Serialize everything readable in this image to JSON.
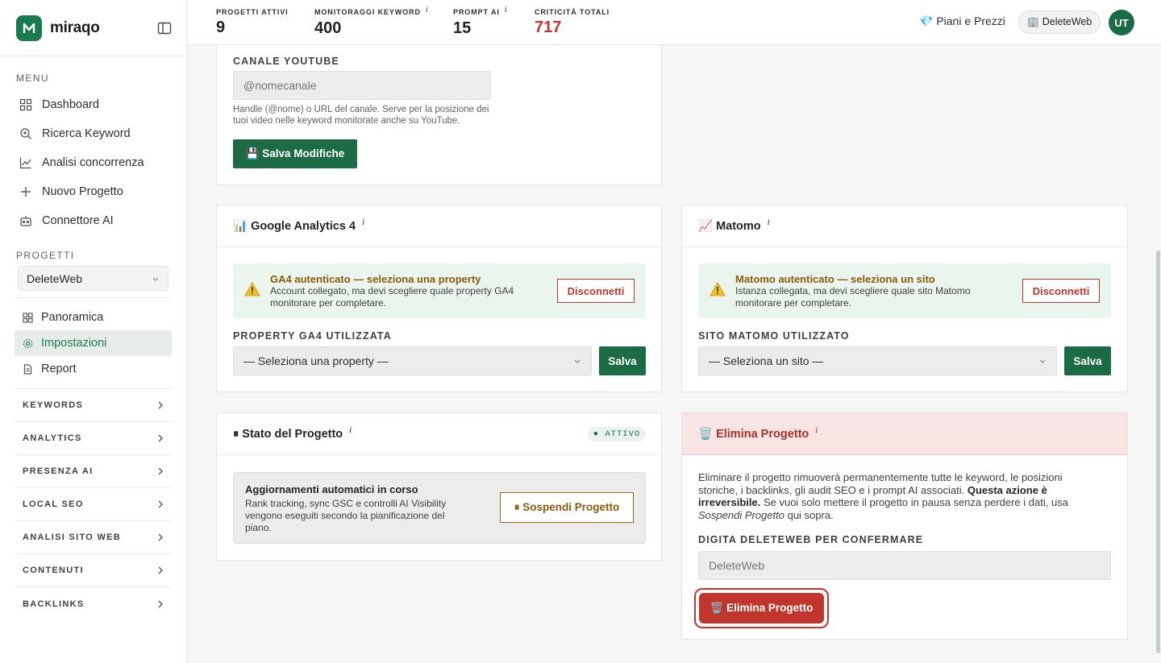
{
  "brand": {
    "name": "miraqo"
  },
  "sidebar": {
    "menu_label": "MENU",
    "menu_items": [
      {
        "label": "Dashboard"
      },
      {
        "label": "Ricerca Keyword"
      },
      {
        "label": "Analisi concorrenza"
      },
      {
        "label": "Nuovo Progetto"
      },
      {
        "label": "Connettore AI"
      }
    ],
    "projects_label": "PROGETTI",
    "project_select": "DeleteWeb",
    "project_items": [
      {
        "label": "Panoramica"
      },
      {
        "label": "Impostazioni"
      },
      {
        "label": "Report"
      }
    ],
    "groups": [
      {
        "label": "KEYWORDS"
      },
      {
        "label": "ANALYTICS"
      },
      {
        "label": "PRESENZA AI"
      },
      {
        "label": "LOCAL SEO"
      },
      {
        "label": "ANALISI SITO WEB"
      },
      {
        "label": "CONTENUTI"
      },
      {
        "label": "BACKLINKS"
      }
    ]
  },
  "topbar": {
    "stats": [
      {
        "label": "PROGETTI ATTIVI",
        "info": "",
        "value": "9",
        "color": "#1f2422"
      },
      {
        "label": "MONITORAGGI KEYWORD",
        "info": "i",
        "value": "400",
        "color": "#1f2422"
      },
      {
        "label": "PROMPT AI",
        "info": "i",
        "value": "15",
        "color": "#1f2422"
      },
      {
        "label": "CRITICITÀ TOTALI",
        "info": "",
        "value": "717",
        "color": "#c0362c"
      }
    ],
    "plans_label": "💎 Piani e Prezzi",
    "workspace_label": "🏢 DeleteWeb",
    "avatar_initials": "UT"
  },
  "youtube": {
    "label": "CANALE YOUTUBE",
    "placeholder": "@nomecanale",
    "help": "Handle (@nome) o URL del canale. Serve per la posizione dei tuoi video nelle keyword monitorate anche su YouTube.",
    "save_label": "💾 Salva Modifiche"
  },
  "ga4": {
    "title": "📊 Google Analytics 4",
    "info": "i",
    "alert_title": "GA4 autenticato — seleziona una property",
    "alert_text": "Account collegato, ma devi scegliere quale property GA4 monitorare per completare.",
    "disconnect_label": "Disconnetti",
    "field_label": "PROPERTY GA4 UTILIZZATA",
    "select_value": "— Seleziona una property —",
    "save_label": "Salva"
  },
  "matomo": {
    "title": "📈 Matomo",
    "info": "i",
    "alert_title": "Matomo autenticato — seleziona un sito",
    "alert_text": "Istanza collegata, ma devi scegliere quale sito Matomo monitorare per completare.",
    "disconnect_label": "Disconnetti",
    "field_label": "SITO MATOMO UTILIZZATO",
    "select_value": "— Seleziona un sito —",
    "save_label": "Salva"
  },
  "status": {
    "title": "⏸ Stato del Progetto",
    "info": "i",
    "badge": "● ATTIVO",
    "box_title": "Aggiornamenti automatici in corso",
    "box_text": "Rank tracking, sync GSC e controlli AI Visibility vengono eseguiti secondo la pianificazione del piano.",
    "suspend_label": "⏸ Sospendi Progetto"
  },
  "delete": {
    "title": "🗑️ Elimina Progetto",
    "info": "i",
    "text_part1": "Eliminare il progetto rimuoverà permanentemente tutte le keyword, le posizioni storiche, i backlinks, gli audit SEO e i prompt AI associati.",
    "text_bold": "Questa azione è irreversibile.",
    "text_part2": "Se vuoi solo mettere il progetto in pausa senza perdere i dati, usa",
    "text_italic": "Sospendi Progetto",
    "text_part3": "qui sopra.",
    "confirm_label": "DIGITA DELETEWEB PER CONFERMARE",
    "confirm_placeholder": "DeleteWeb",
    "button_label": "🗑️ Elimina Progetto"
  },
  "colors": {
    "accent": "#1b6b44",
    "danger": "#c0362c",
    "warning": "#8a5a0c"
  }
}
